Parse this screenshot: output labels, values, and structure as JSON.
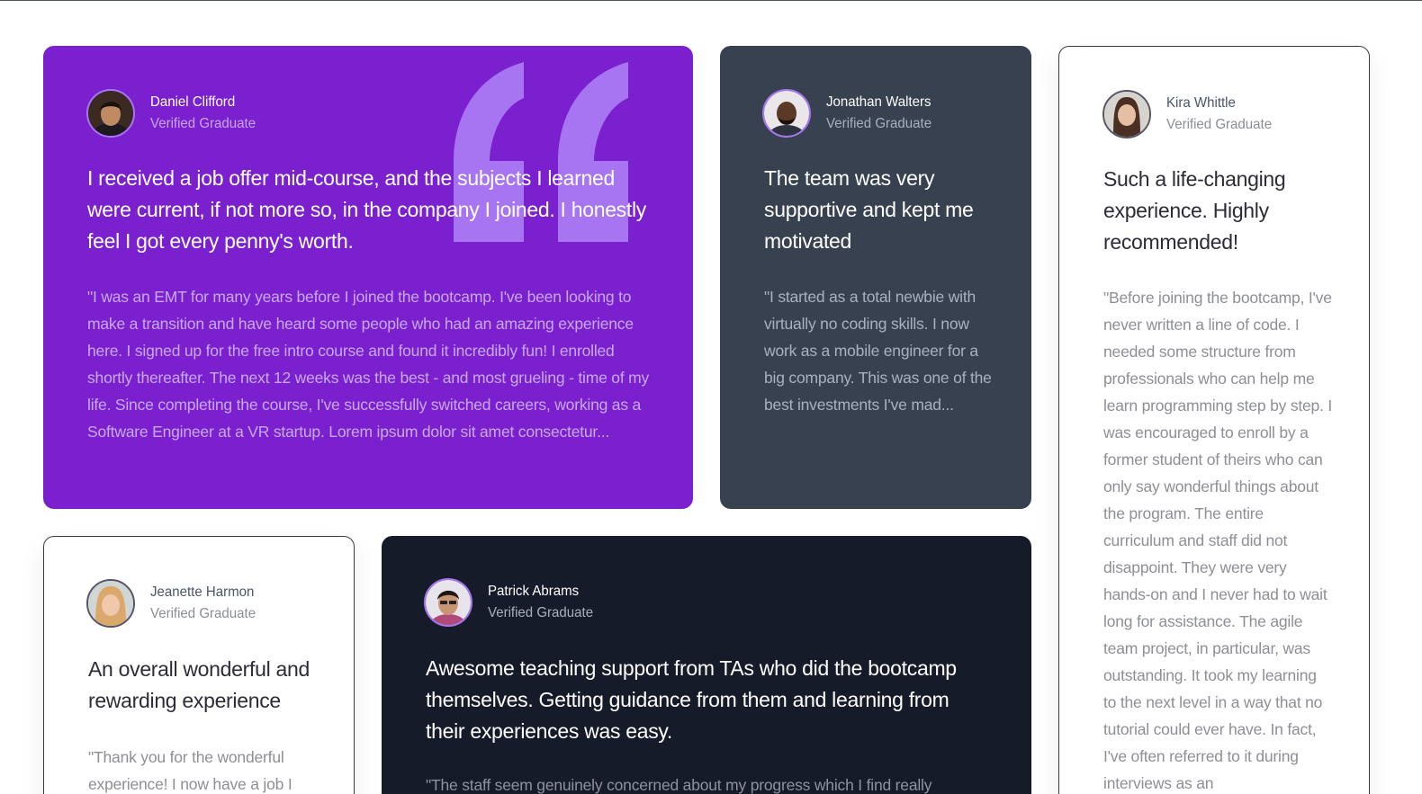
{
  "colors": {
    "purple": "#7b20cf",
    "slate": "#374150",
    "navy": "#151b28",
    "white": "#ffffff",
    "quote": "#a775f1"
  },
  "testimonials": [
    {
      "name": "Daniel Clifford",
      "role": "Verified Graduate",
      "headline": "I received a job offer mid-course, and the subjects I learned were current, if not more so, in the company I joined. I honestly feel I got every penny's worth.",
      "body": "\"I was an EMT for many years before I joined the bootcamp. I've been looking to make a transition and have heard some people who had an amazing experience here. I signed up for the free intro course and found it incredibly fun! I enrolled shortly thereafter. The next 12 weeks was the best - and most grueling - time of my life. Since completing the course, I've successfully switched careers, working as a Software Engineer at a VR startup. Lorem ipsum dolor sit amet consectetur..."
    },
    {
      "name": "Jonathan Walters",
      "role": "Verified Graduate",
      "headline": "The team was very supportive and kept me motivated",
      "body": "\"I started as a total newbie with virtually no coding skills. I now work as a mobile engineer for a big company. This was one of the best investments I've mad..."
    },
    {
      "name": "Kira Whittle",
      "role": "Verified Graduate",
      "headline": "Such a life-changing experience. Highly recommended!",
      "body": "\"Before joining the bootcamp, I've never written a line of code. I needed some structure from professionals who can help me learn programming step by step. I was encouraged to enroll by a former student of theirs who can only say wonderful things about the program. The entire curriculum and staff did not disappoint. They were very hands-on and I never had to wait long for assistance. The agile team project, in particular, was outstanding. It took my learning to the next level in a way that no tutorial could ever have. In fact, I've often referred to it during interviews as an"
    },
    {
      "name": "Jeanette Harmon",
      "role": "Verified Graduate",
      "headline": "An overall wonderful and rewarding experience",
      "body": "\"Thank you for the wonderful experience! I now have a job I"
    },
    {
      "name": "Patrick Abrams",
      "role": "Verified Graduate",
      "headline": "Awesome teaching support from TAs who did the bootcamp themselves. Getting guidance from them and learning from their experiences was easy.",
      "body": "\"The staff seem genuinely concerned about my progress which I find really"
    }
  ]
}
